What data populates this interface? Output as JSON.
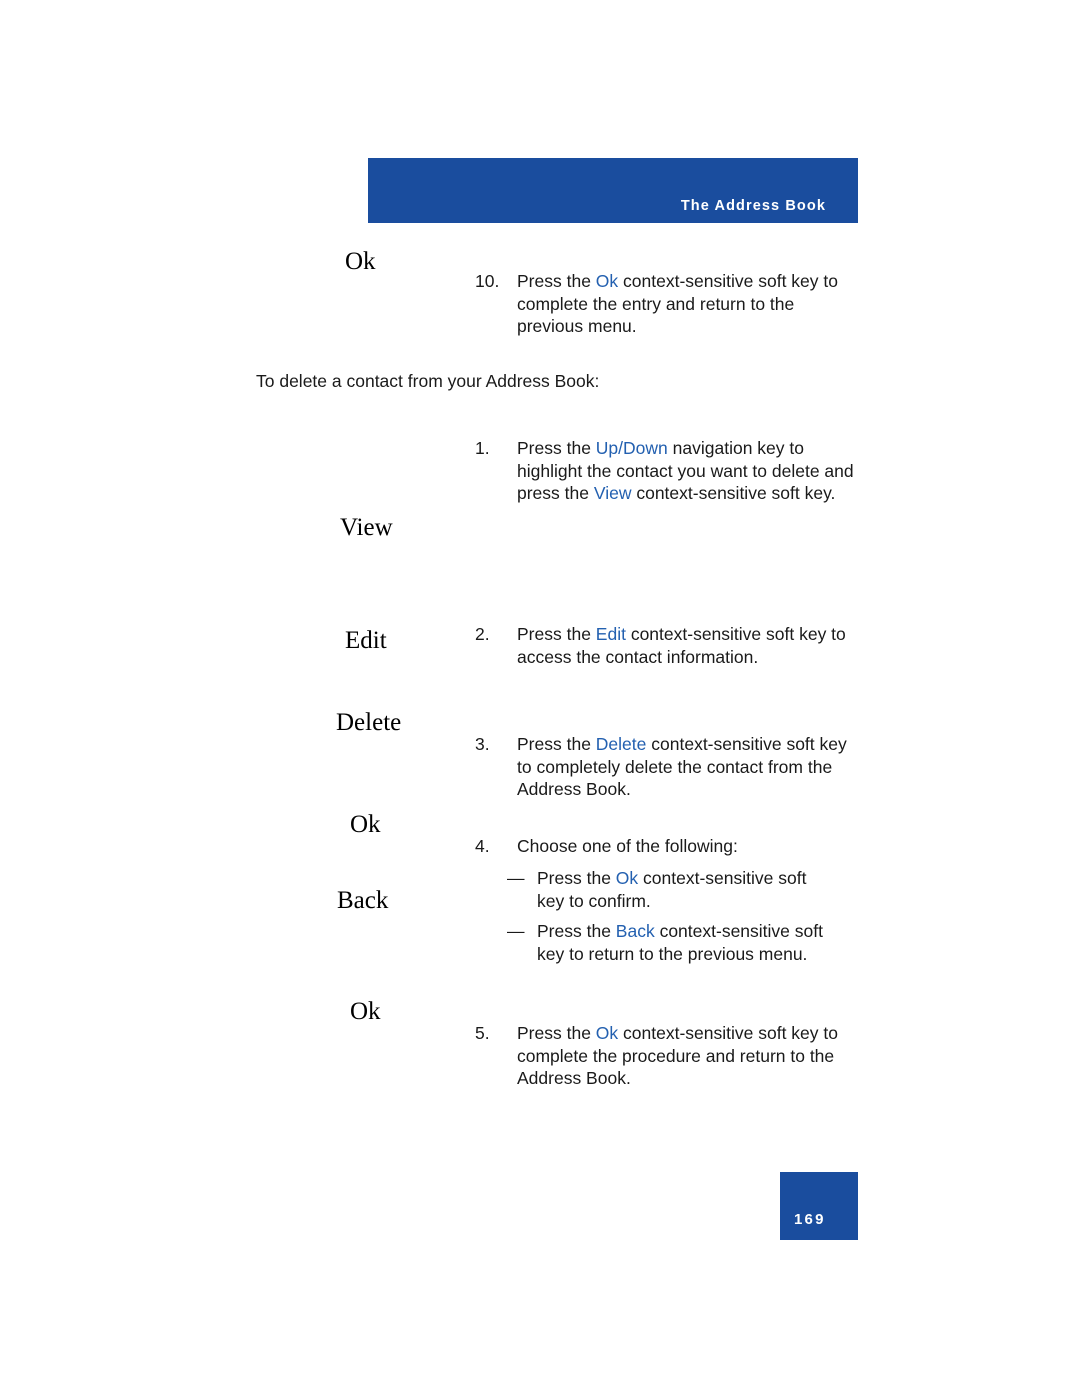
{
  "header": {
    "title": "The Address Book"
  },
  "softkeys": [
    {
      "label": "Ok"
    },
    {
      "label": "View"
    },
    {
      "label": "Edit"
    },
    {
      "label": "Delete"
    },
    {
      "label": "Ok"
    },
    {
      "label": "Back"
    },
    {
      "label": "Ok"
    }
  ],
  "body": {
    "step10": {
      "number": "10.",
      "pre": "Press the ",
      "kw": "Ok",
      "post": " context-sensitive soft key to complete the entry and return to the previous menu."
    },
    "intro": "To delete a contact from your Address Book:",
    "step1": {
      "number": "1.",
      "pre": "Press the ",
      "kw1": "Up/Down",
      "mid": " navigation key to highlight the contact you want to delete and press the ",
      "kw2": "View",
      "post": " context-sensitive soft key."
    },
    "step2": {
      "number": "2.",
      "pre": "Press the ",
      "kw": "Edit",
      "post": " context-sensitive soft key to access the contact information."
    },
    "step3": {
      "number": "3.",
      "pre": "Press the ",
      "kw": "Delete",
      "post": " context-sensitive soft key to completely delete the contact from the Address Book."
    },
    "step4": {
      "number": "4.",
      "text": "Choose one of the following:",
      "bullet1": {
        "dash": "—",
        "pre": "Press the ",
        "kw": "Ok",
        "post": " context-sensitive soft key to confirm."
      },
      "bullet2": {
        "dash": "—",
        "pre": "Press the ",
        "kw": "Back",
        "post": " context-sensitive soft key to return to the previous menu."
      }
    },
    "step5": {
      "number": "5.",
      "pre": "Press the ",
      "kw": "Ok",
      "post": " context-sensitive soft key to complete the procedure and return to the Address Book."
    }
  },
  "footer": {
    "page_number": "169"
  }
}
